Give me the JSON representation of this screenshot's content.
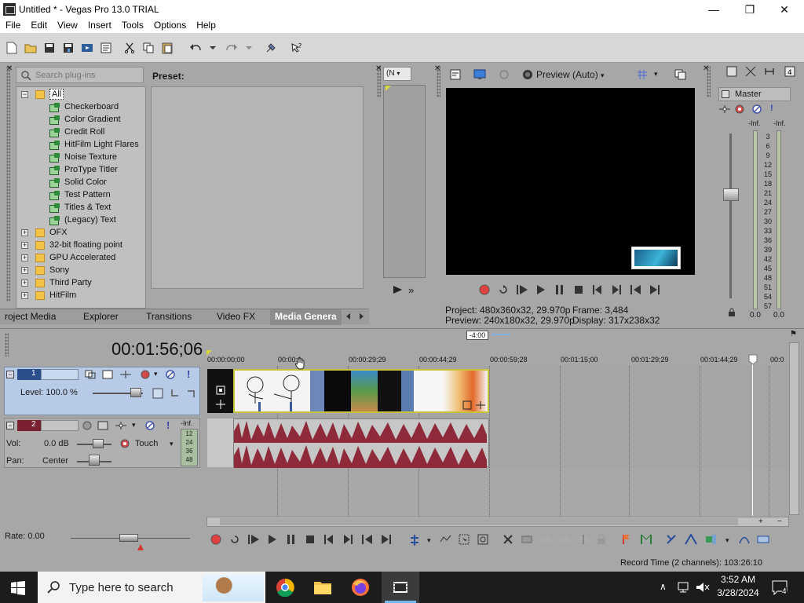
{
  "window": {
    "title": "Untitled * - Vegas Pro 13.0 TRIAL"
  },
  "menu": [
    "File",
    "Edit",
    "View",
    "Insert",
    "Tools",
    "Options",
    "Help"
  ],
  "plugins": {
    "search_placeholder": "Search plug-ins",
    "preset_label": "Preset:",
    "root": "All",
    "items": [
      "Checkerboard",
      "Color Gradient",
      "Credit Roll",
      "HitFilm Light Flares",
      "Noise Texture",
      "ProType Titler",
      "Solid Color",
      "Test Pattern",
      "Titles & Text",
      "(Legacy) Text"
    ],
    "folders": [
      "OFX",
      "32-bit floating point",
      "GPU Accelerated",
      "Sony",
      "Third Party",
      "HitFilm"
    ]
  },
  "tabs": [
    "roject Media",
    "Explorer",
    "Transitions",
    "Video FX",
    "Media Genera"
  ],
  "trimmer": {
    "dropdown": "(N"
  },
  "preview": {
    "mode": "Preview (Auto)",
    "project_label": "Project:",
    "project_value": "480x360x32, 29.970p",
    "frame_label": "Frame:",
    "frame_value": "3,484",
    "preview_label": "Preview:",
    "preview_value": "240x180x32, 29.970p",
    "display_label": "Display:",
    "display_value": "317x238x32"
  },
  "master": {
    "label": "Master",
    "inf_left": "-Inf.",
    "inf_right": "-Inf.",
    "scale": [
      "3",
      "6",
      "9",
      "12",
      "15",
      "18",
      "21",
      "24",
      "27",
      "30",
      "33",
      "36",
      "39",
      "42",
      "45",
      "48",
      "51",
      "54",
      "57"
    ],
    "val_left": "0.0",
    "val_right": "0.0"
  },
  "timeline": {
    "timecode": "00:01:56;06",
    "marker": "-4:00",
    "ruler": [
      "00:00:00;00",
      "00:00:1",
      "00:00:29;29",
      "00:00:44;29",
      "00:00:59;28",
      "00:01:15;00",
      "00:01:29;29",
      "00:01:44;29",
      "00:0"
    ],
    "video_track": {
      "number": "1",
      "level": "Level: 100.0 %"
    },
    "audio_track": {
      "number": "2",
      "vol_label": "Vol:",
      "vol_value": "0.0 dB",
      "touch": "Touch",
      "pan_label": "Pan:",
      "pan_value": "Center",
      "inf": "-Inf.",
      "meter": [
        "12",
        "24",
        "36",
        "48"
      ]
    },
    "rate": "Rate: 0.00"
  },
  "status": {
    "record_time": "Record Time (2 channels): 103:26:10"
  },
  "taskbar": {
    "search_placeholder": "Type here to search",
    "time": "3:52 AM",
    "date": "3/28/2024",
    "notifications": "4"
  },
  "colors": {
    "video_head": "#b8cbe6",
    "clip_border": "#c7c43a",
    "wave": "#8e2a3a",
    "taskbar": "#1c1c1c"
  }
}
